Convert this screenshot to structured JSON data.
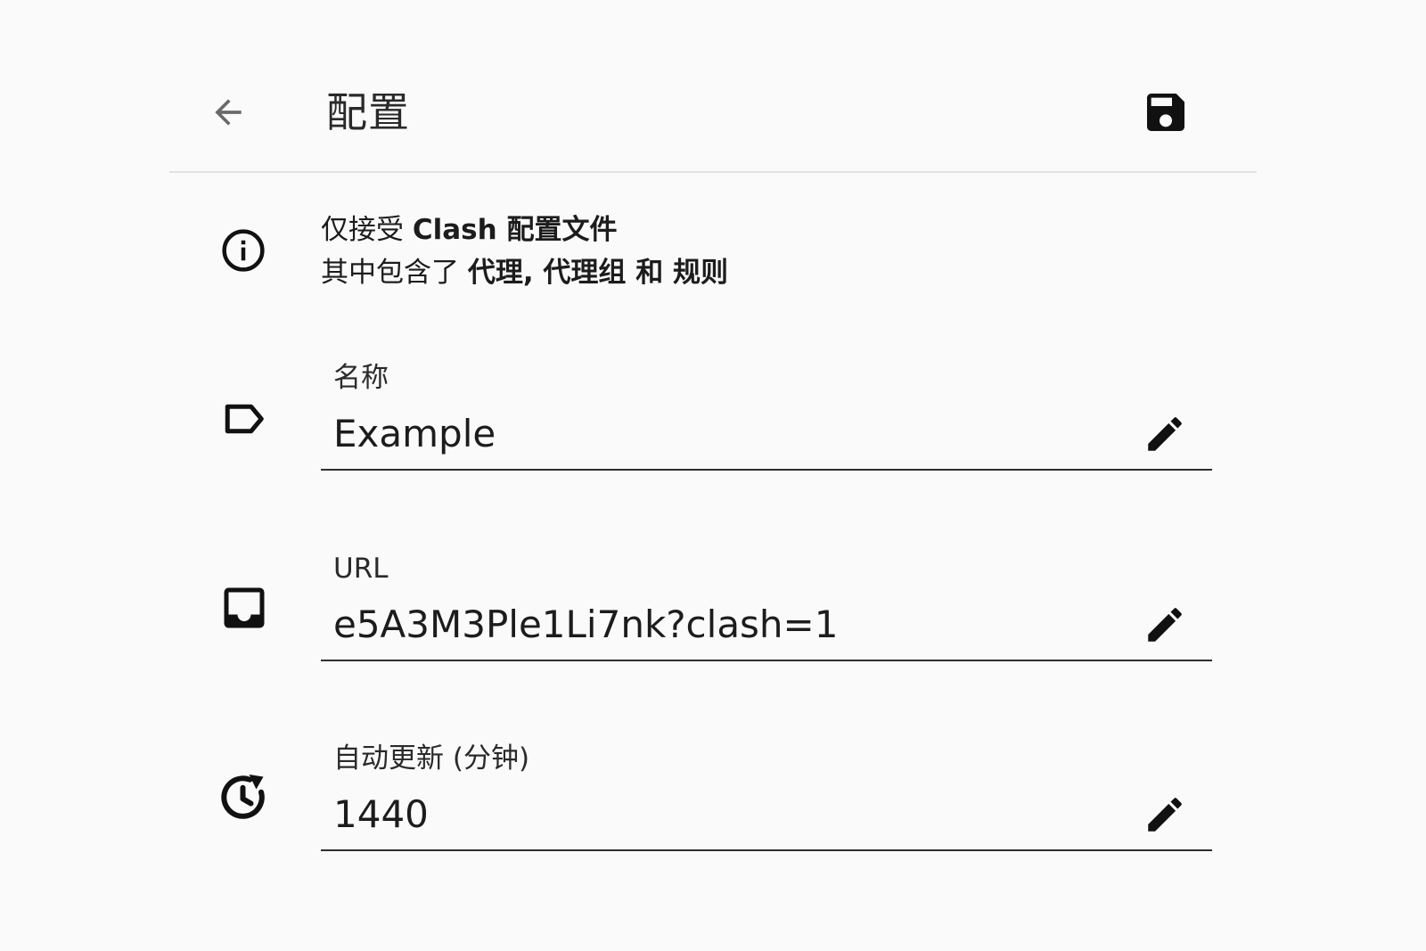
{
  "header": {
    "title": "配置",
    "back_icon": "arrow-back-icon",
    "save_icon": "save-icon"
  },
  "info": {
    "line1_prefix": "仅接受 ",
    "line1_bold": "Clash 配置文件",
    "line2_prefix": "其中包含了 ",
    "line2_bold": "代理, 代理组 和 规则",
    "icon": "info-icon"
  },
  "fields": {
    "name": {
      "label": "名称",
      "value": "Example",
      "icon": "label-tag-icon"
    },
    "url": {
      "label": "URL",
      "value": "e5A3M3Ple1Li7nk?clash=1",
      "icon": "inbox-icon"
    },
    "interval": {
      "label": "自动更新 (分钟)",
      "value": "1440",
      "icon": "update-clock-icon"
    }
  },
  "colors": {
    "background": "#fafafa",
    "text": "#1c1c1c",
    "divider": "#e3e3e3",
    "underline": "#2e2e2e"
  }
}
